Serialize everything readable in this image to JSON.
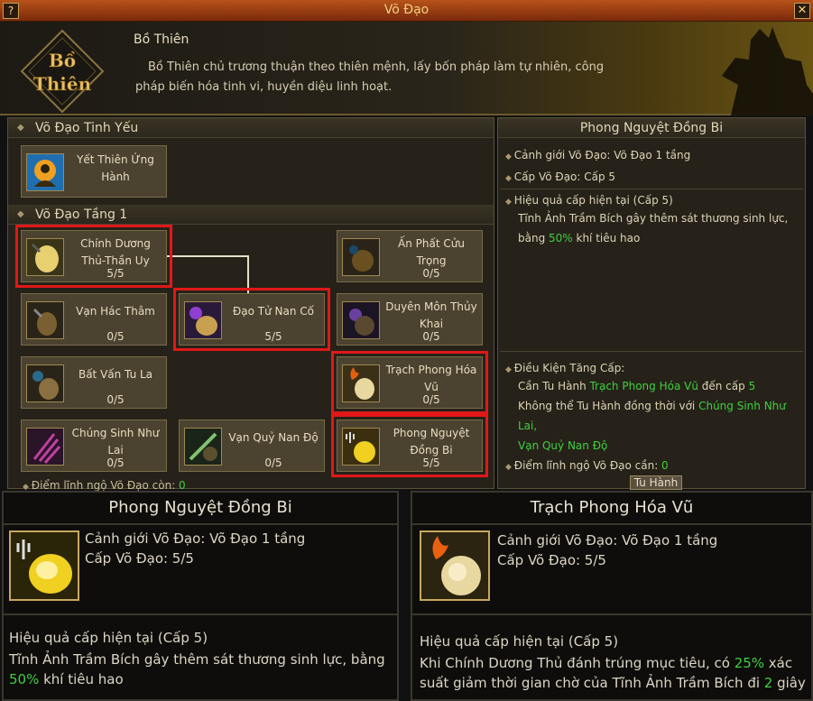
{
  "window": {
    "title": "Võ Đạo",
    "help": "?",
    "close": "✕"
  },
  "header": {
    "emblem_text": "Bồ Thiên",
    "name": "Bồ Thiên",
    "desc": "Bồ Thiên chủ trương thuận theo thiên mệnh, lấy bốn pháp làm tự nhiên, công pháp biến hóa tinh vi, huyền diệu linh hoạt."
  },
  "tree": {
    "sec1": "Võ Đạo Tinh Yếu",
    "sec2": "Võ Đạo Tầng 1",
    "core": {
      "name": "Yết Thiên Ứng Hành"
    },
    "nodes": [
      {
        "name": "Chính Dương Thủ-Thần Uy",
        "level": "5/5"
      },
      {
        "name": "Ấn Phất Cửu Trọng",
        "level": "0/5"
      },
      {
        "name": "Vạn Hác Thâm",
        "level": "0/5"
      },
      {
        "name": "Đạo Tử Nan Cố",
        "level": "5/5"
      },
      {
        "name": "Duyên Môn Thủy Khai",
        "level": "0/5"
      },
      {
        "name": "Bất Vấn Tu La",
        "level": "0/5"
      },
      {
        "name": "Trạch Phong Hóa Vũ",
        "level": "0/5"
      },
      {
        "name": "Chúng Sinh Như Lai",
        "level": "0/5"
      },
      {
        "name": "Vạn Quỷ Nan Độ",
        "level": "0/5"
      },
      {
        "name": "Phong Nguyệt Đồng Bi",
        "level": "5/5"
      }
    ],
    "points_label": "Điểm lĩnh ngộ Võ Đạo còn:",
    "points_value": "0"
  },
  "detail": {
    "title": "Phong Nguyệt Đồng Bi",
    "realm": "Cảnh giới Võ Đạo: Võ Đạo 1 tầng",
    "level": "Cấp Võ Đạo: Cấp 5",
    "effect_title": "Hiệu quả cấp hiện tại (Cấp 5)",
    "effect_a": "Tĩnh Ảnh Trầm Bích gây thêm sát thương sinh lực,",
    "effect_b": "bằng ",
    "effect_pct": "50%",
    "effect_c": " khí tiêu hao",
    "cond_title": "Điều Kiện Tăng Cấp:",
    "cond1_a": "Cần Tu Hành ",
    "cond1_b": "Trạch Phong Hóa Vũ",
    "cond1_c": " đến cấp ",
    "cond1_d": "5",
    "cond2_a": "Không thể Tu Hành đồng thời với ",
    "cond2_b": "Chúng Sinh Như Lai,",
    "cond2_c": "Vạn Quỷ Nan Độ",
    "need_label": "Điểm lĩnh ngộ Võ Đạo cần: ",
    "need_value": "0",
    "train_button": "Tu Hành"
  },
  "tooltip_left": {
    "title": "Phong Nguyệt Đồng Bi",
    "realm": "Cảnh giới Võ Đạo: Võ Đạo 1 tầng",
    "level": "Cấp Võ Đạo: 5/5",
    "effect_title": "Hiệu quả cấp hiện tại (Cấp 5)",
    "effect_a": "Tĩnh Ảnh Trầm Bích gây thêm sát thương sinh lực, bằng",
    "effect_pct": "50%",
    "effect_c": " khí tiêu hao"
  },
  "tooltip_right": {
    "title": "Trạch Phong Hóa Vũ",
    "realm": "Cảnh giới Võ Đạo: Võ Đạo 1 tầng",
    "level": "Cấp Võ Đạo: 5/5",
    "effect_title": "Hiệu quả cấp hiện tại (Cấp 5)",
    "effect_a": "Khi Chính Dương Thủ đánh trúng mục tiêu, có ",
    "effect_pct": "25%",
    "effect_b": " xác",
    "effect_c": "suất giảm thời gian chờ của Tĩnh Ảnh Trầm Bích đi ",
    "effect_sec": "2",
    "effect_d": " giây"
  },
  "colors": {
    "highlight": "#e01818",
    "green": "#3fd03f",
    "gold": "#c8a860"
  }
}
